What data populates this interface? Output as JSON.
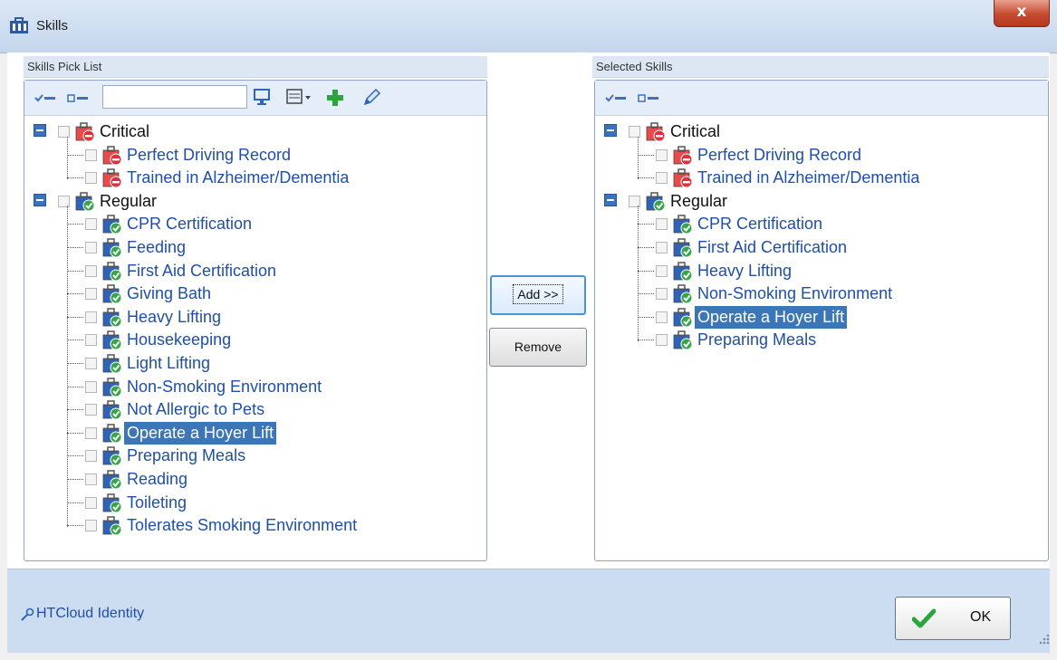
{
  "window": {
    "title": "Skills",
    "close_glyph": "x",
    "icon": "briefcase-icon"
  },
  "pick_list": {
    "header": "Skills Pick List",
    "search_value": "",
    "tree": [
      {
        "kind": "group",
        "label": "Critical",
        "icon": "critical-skill-icon",
        "children": [
          "Perfect Driving Record",
          "Trained in Alzheimer/Dementia"
        ]
      },
      {
        "kind": "group",
        "label": "Regular",
        "icon": "regular-skill-icon",
        "children": [
          "CPR Certification",
          "Feeding",
          "First Aid Certification",
          "Giving Bath",
          "Heavy Lifting",
          "Housekeeping",
          "Light Lifting",
          "Non-Smoking Environment",
          "Not Allergic to Pets",
          "Operate a Hoyer Lift",
          "Preparing Meals",
          "Reading",
          "Toileting",
          "Tolerates Smoking Environment"
        ]
      }
    ],
    "selected_item": "Operate a Hoyer Lift"
  },
  "selected_skills": {
    "header": "Selected Skills",
    "tree": [
      {
        "kind": "group",
        "label": "Critical",
        "icon": "critical-skill-icon",
        "children": [
          "Perfect Driving Record",
          "Trained in Alzheimer/Dementia"
        ]
      },
      {
        "kind": "group",
        "label": "Regular",
        "icon": "regular-skill-icon",
        "children": [
          "CPR Certification",
          "First Aid Certification",
          "Heavy Lifting",
          "Non-Smoking Environment",
          "Operate a Hoyer Lift",
          "Preparing Meals"
        ]
      }
    ],
    "selected_item": "Operate a Hoyer Lift"
  },
  "buttons": {
    "add": "Add >>",
    "remove": "Remove",
    "ok": "OK"
  },
  "footer": {
    "link": "HTCloud Identity"
  },
  "colors": {
    "selection": "#3d76b7",
    "link": "#1f4fa6",
    "critical": "#e0303a",
    "regular": "#2a8a3a",
    "accent": "#3a72c2"
  }
}
